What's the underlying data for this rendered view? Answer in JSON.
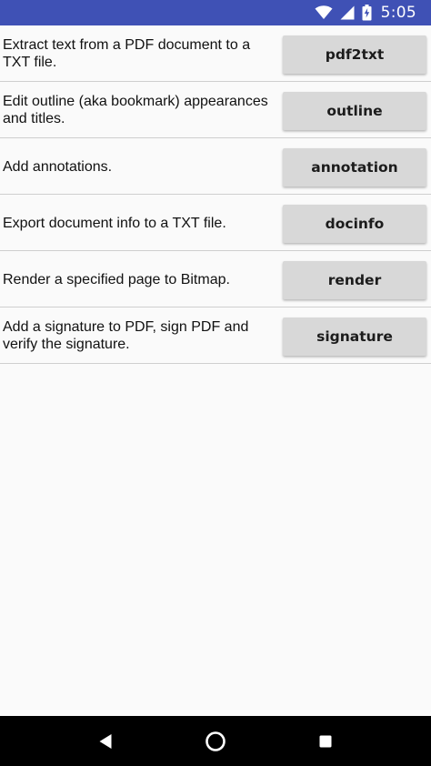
{
  "status_bar": {
    "time": "5:05",
    "icons": [
      "wifi-icon",
      "cell-signal-icon",
      "battery-charging-icon"
    ],
    "color": "#3f51b5"
  },
  "rows": [
    {
      "description": "Extract text from a PDF document to a TXT file.",
      "button_label": "pdf2txt"
    },
    {
      "description": "Edit outline (aka bookmark) appearances and titles.",
      "button_label": "outline"
    },
    {
      "description": "Add annotations.",
      "button_label": "annotation"
    },
    {
      "description": "Export document info to a TXT file.",
      "button_label": "docinfo"
    },
    {
      "description": "Render a specified page to Bitmap.",
      "button_label": "render"
    },
    {
      "description": "Add a signature to PDF, sign PDF and verify the signature.",
      "button_label": "signature"
    }
  ],
  "nav_bar": {
    "buttons": [
      "back-icon",
      "home-icon",
      "recents-icon"
    ]
  }
}
